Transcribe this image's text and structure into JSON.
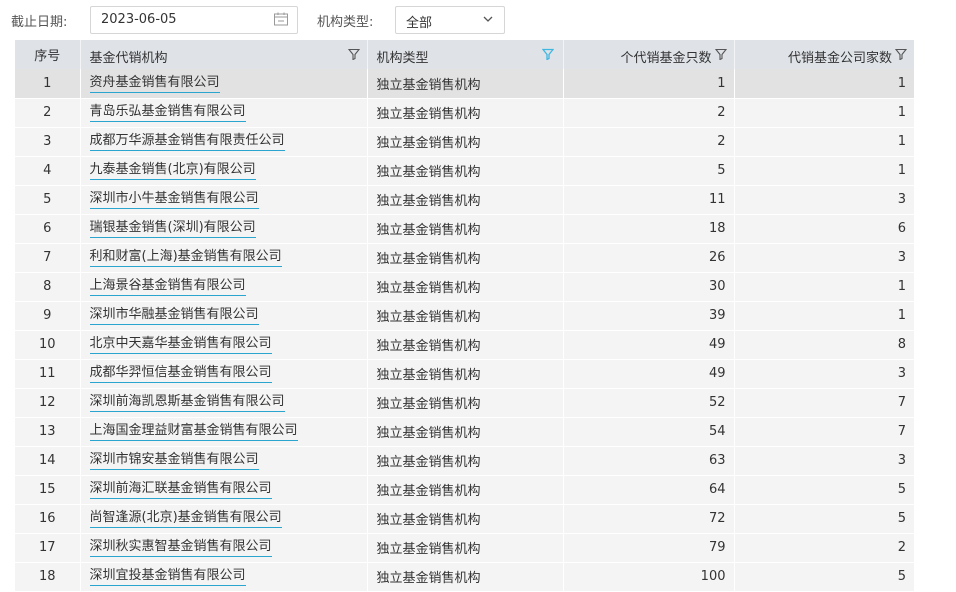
{
  "filters": {
    "date_label": "截止日期:",
    "date_value": "2023-06-05",
    "type_label": "机构类型:",
    "type_value": "全部"
  },
  "table": {
    "headers": {
      "idx": "序号",
      "name": "基金代销机构",
      "type": "机构类型",
      "count": "个代销基金只数",
      "companies": "代销基金公司家数"
    },
    "rows": [
      {
        "idx": "1",
        "name": "资舟基金销售有限公司",
        "type": "独立基金销售机构",
        "count": "1",
        "companies": "1"
      },
      {
        "idx": "2",
        "name": "青岛乐弘基金销售有限公司",
        "type": "独立基金销售机构",
        "count": "2",
        "companies": "1"
      },
      {
        "idx": "3",
        "name": "成都万华源基金销售有限责任公司",
        "type": "独立基金销售机构",
        "count": "2",
        "companies": "1"
      },
      {
        "idx": "4",
        "name": "九泰基金销售(北京)有限公司",
        "type": "独立基金销售机构",
        "count": "5",
        "companies": "1"
      },
      {
        "idx": "5",
        "name": "深圳市小牛基金销售有限公司",
        "type": "独立基金销售机构",
        "count": "11",
        "companies": "3"
      },
      {
        "idx": "6",
        "name": "瑞银基金销售(深圳)有限公司",
        "type": "独立基金销售机构",
        "count": "18",
        "companies": "6"
      },
      {
        "idx": "7",
        "name": "利和财富(上海)基金销售有限公司",
        "type": "独立基金销售机构",
        "count": "26",
        "companies": "3"
      },
      {
        "idx": "8",
        "name": "上海景谷基金销售有限公司",
        "type": "独立基金销售机构",
        "count": "30",
        "companies": "1"
      },
      {
        "idx": "9",
        "name": "深圳市华融基金销售有限公司",
        "type": "独立基金销售机构",
        "count": "39",
        "companies": "1"
      },
      {
        "idx": "10",
        "name": "北京中天嘉华基金销售有限公司",
        "type": "独立基金销售机构",
        "count": "49",
        "companies": "8"
      },
      {
        "idx": "11",
        "name": "成都华羿恒信基金销售有限公司",
        "type": "独立基金销售机构",
        "count": "49",
        "companies": "3"
      },
      {
        "idx": "12",
        "name": "深圳前海凯恩斯基金销售有限公司",
        "type": "独立基金销售机构",
        "count": "52",
        "companies": "7"
      },
      {
        "idx": "13",
        "name": "上海国金理益财富基金销售有限公司",
        "type": "独立基金销售机构",
        "count": "54",
        "companies": "7"
      },
      {
        "idx": "14",
        "name": "深圳市锦安基金销售有限公司",
        "type": "独立基金销售机构",
        "count": "63",
        "companies": "3"
      },
      {
        "idx": "15",
        "name": "深圳前海汇联基金销售有限公司",
        "type": "独立基金销售机构",
        "count": "64",
        "companies": "5"
      },
      {
        "idx": "16",
        "name": "尚智逢源(北京)基金销售有限公司",
        "type": "独立基金销售机构",
        "count": "72",
        "companies": "5"
      },
      {
        "idx": "17",
        "name": "深圳秋实惠智基金销售有限公司",
        "type": "独立基金销售机构",
        "count": "79",
        "companies": "2"
      },
      {
        "idx": "18",
        "name": "深圳宜投基金销售有限公司",
        "type": "独立基金销售机构",
        "count": "100",
        "companies": "5"
      }
    ]
  },
  "colors": {
    "header_bg": "#dfe3e8",
    "row_bg": "#f4f4f4",
    "active_row_bg": "#e2e2e2",
    "link_underline": "#2aa5cf",
    "filter_active": "#3fb6e0"
  },
  "icons": {
    "date_picker": "calendar-icon",
    "type_select": "chevron-down-icon",
    "column_filter": "filter-icon",
    "sort_indicator": "sort-up-icon"
  }
}
